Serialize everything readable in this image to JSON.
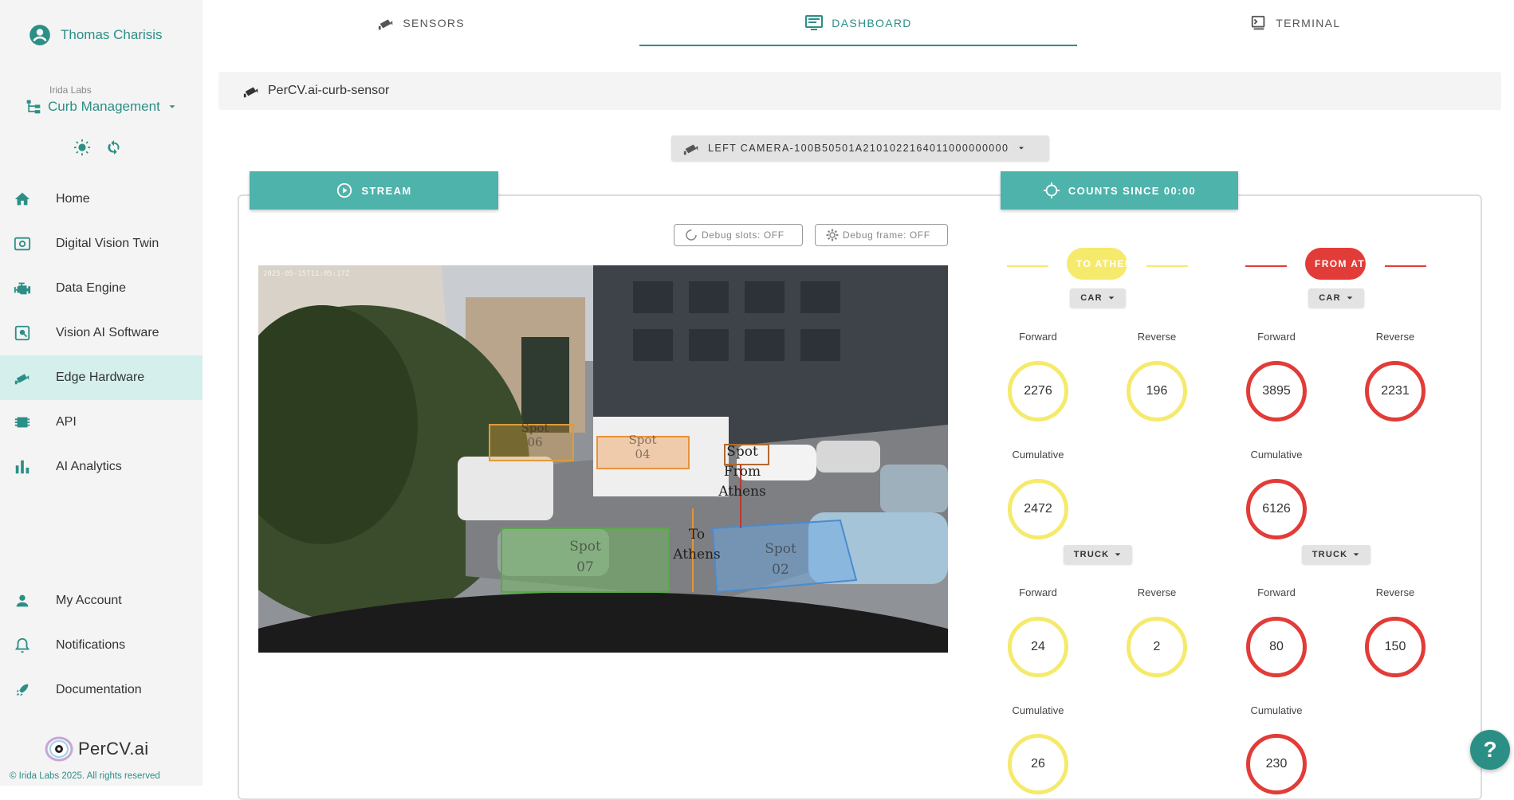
{
  "user": {
    "name": "Thomas Charisis"
  },
  "org": {
    "small_label": "Irida Labs",
    "name": "Curb Management"
  },
  "nav": {
    "home": "Home",
    "digital_twin": "Digital Vision Twin",
    "data_engine": "Data Engine",
    "vision_ai": "Vision AI Software",
    "edge_hardware": "Edge Hardware",
    "api": "API",
    "ai_analytics": "AI Analytics",
    "my_account": "My Account",
    "notifications": "Notifications",
    "documentation": "Documentation"
  },
  "brand": {
    "name": "PerCV.ai",
    "copyright": "© Irida Labs 2025. All rights reserved"
  },
  "tabs": {
    "sensors": "SENSORS",
    "dashboard": "DASHBOARD",
    "terminal": "TERMINAL"
  },
  "sensor": {
    "name": "PerCV.ai-curb-sensor"
  },
  "camera": {
    "selected": "LEFT CAMERA-100B50501A2101022164011000000000"
  },
  "stream_button": "STREAM",
  "counts_button": "COUNTS SINCE 00:00",
  "debug": {
    "slots": "Debug slots: OFF",
    "frame": "Debug frame: OFF"
  },
  "stream_labels": {
    "spot06": "Spot 06",
    "spot04": "Spot 04",
    "spot_from": "Spot From Athens",
    "spot07": "Spot 07",
    "to_athens": "To Athens",
    "spot02": "Spot 02",
    "timestamp": "2025-05-15T11:05:17Z"
  },
  "counts": {
    "to": {
      "label": "TO ATHENS",
      "color": "#f5ea6c",
      "car_label": "CAR",
      "truck_label": "TRUCK",
      "car": {
        "forward": "2276",
        "reverse": "196",
        "cumulative": "2472"
      },
      "truck": {
        "forward": "24",
        "reverse": "2",
        "cumulative": "26"
      }
    },
    "from": {
      "label": "FROM ATHENS",
      "color": "#e23c38",
      "car_label": "CAR",
      "truck_label": "TRUCK",
      "car": {
        "forward": "3895",
        "reverse": "2231",
        "cumulative": "6126"
      },
      "truck": {
        "forward": "80",
        "reverse": "150",
        "cumulative": "230"
      }
    },
    "labels": {
      "forward": "Forward",
      "reverse": "Reverse",
      "cumulative": "Cumulative"
    }
  },
  "help_icon": "?",
  "colors": {
    "accent": "#2b8f86",
    "accent_light": "#4db3ab",
    "active_bg": "#d4efec"
  }
}
